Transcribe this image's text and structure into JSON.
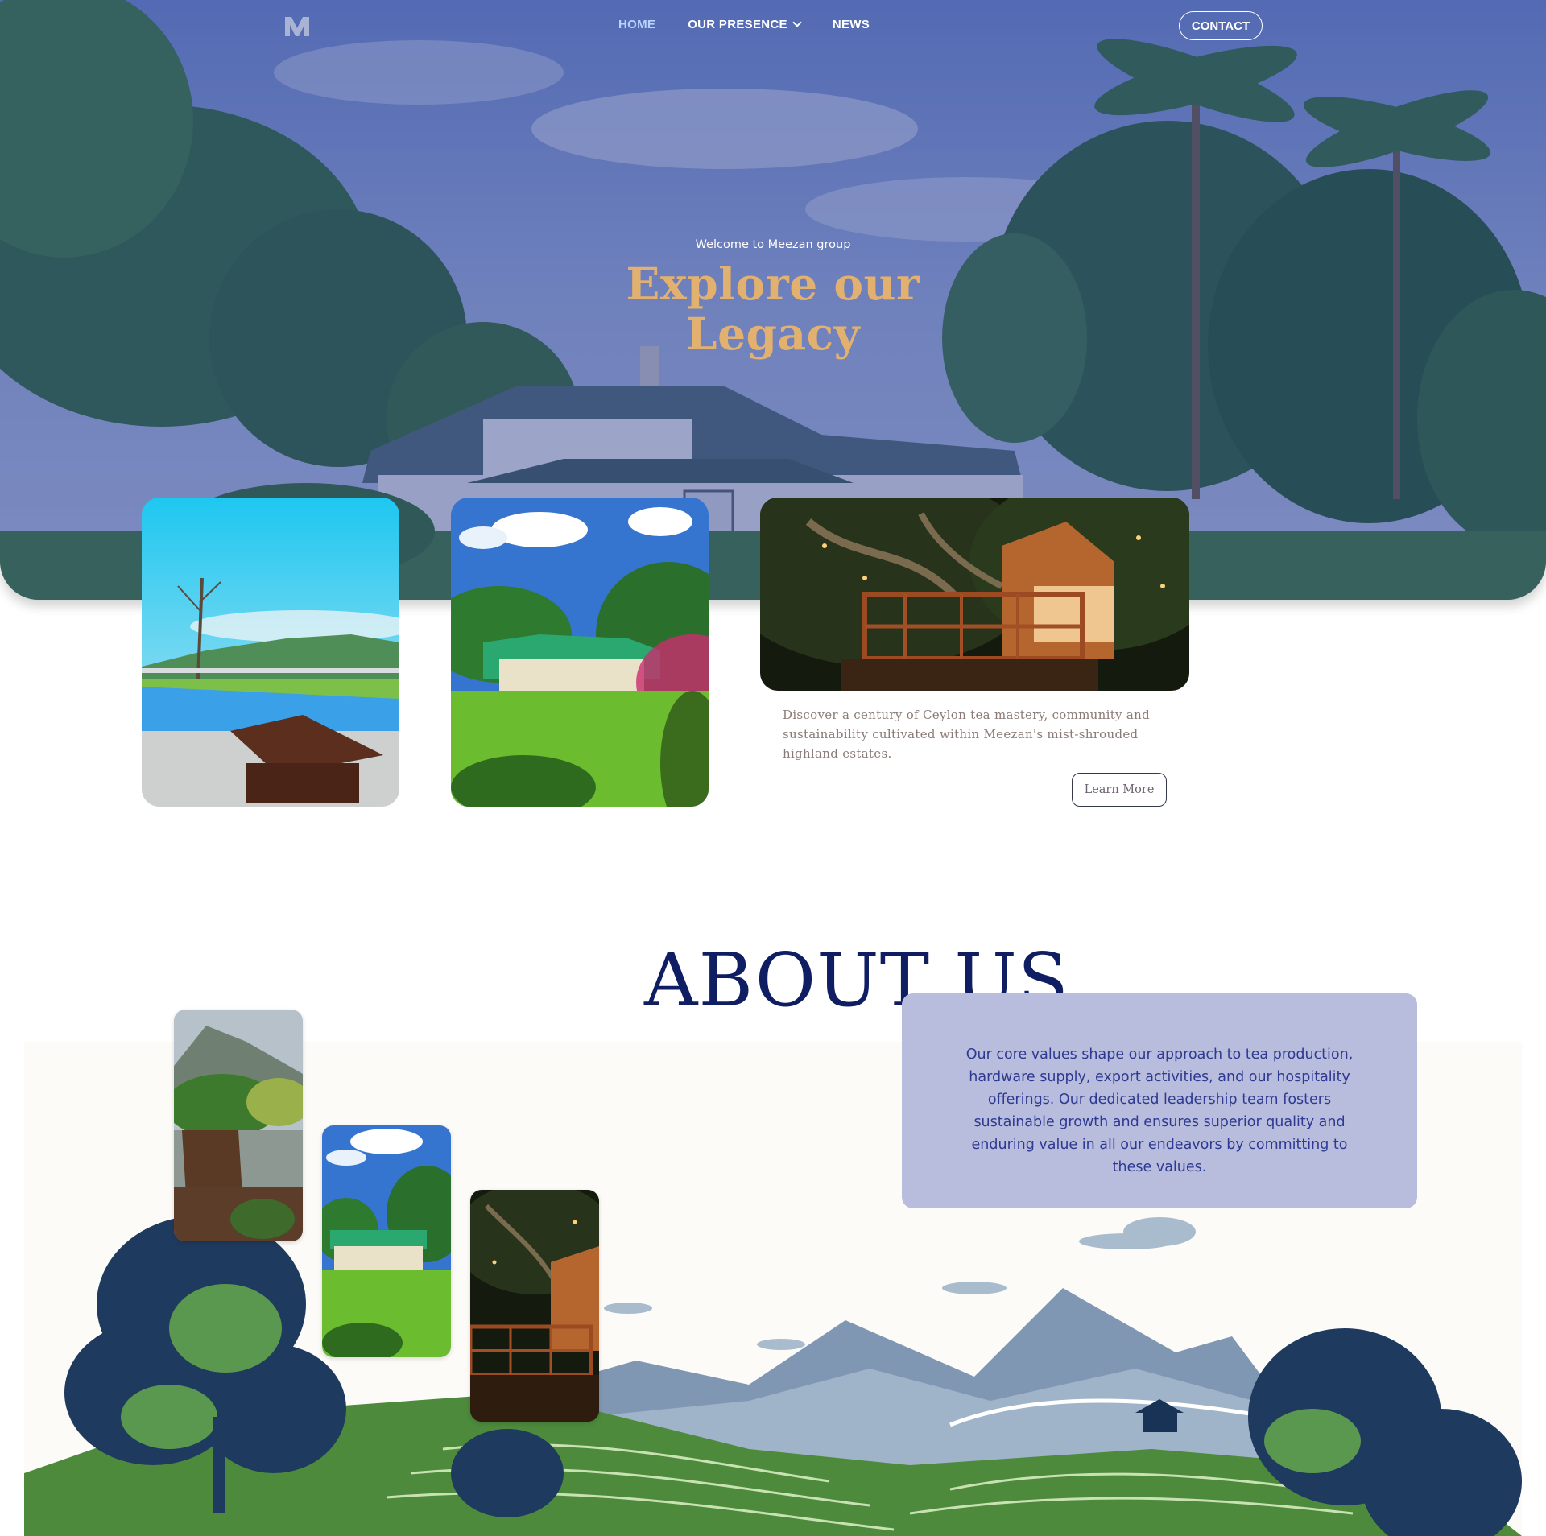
{
  "nav": {
    "logo_alt": "Meezan logo",
    "items": [
      {
        "label": "HOME",
        "active": true
      },
      {
        "label": "OUR PRESENCE",
        "has_dropdown": true
      },
      {
        "label": "NEWS"
      }
    ],
    "contact_label": "CONTACT"
  },
  "hero": {
    "kicker": "Welcome to Meezan group",
    "title_line1": "Explore our",
    "title_line2": "Legacy",
    "overlay_color": "#2e3e8c",
    "title_color": "#e2b16f"
  },
  "intro": {
    "text": "Discover a century of Ceylon tea mastery, community and sustainability cultivated within Meezan's mist-shrouded highland estates.",
    "button_label": "Learn More"
  },
  "about": {
    "title": "ABOUT US",
    "body": "Our core values shape our approach to tea production, hardware supply, export activities, and our hospitality offerings. Our dedicated leadership team fosters sustainable growth and ensures superior quality and enduring value in all our endeavors by committing to these values.",
    "title_color": "#0f1d63",
    "box_color": "#b8bcdd"
  }
}
